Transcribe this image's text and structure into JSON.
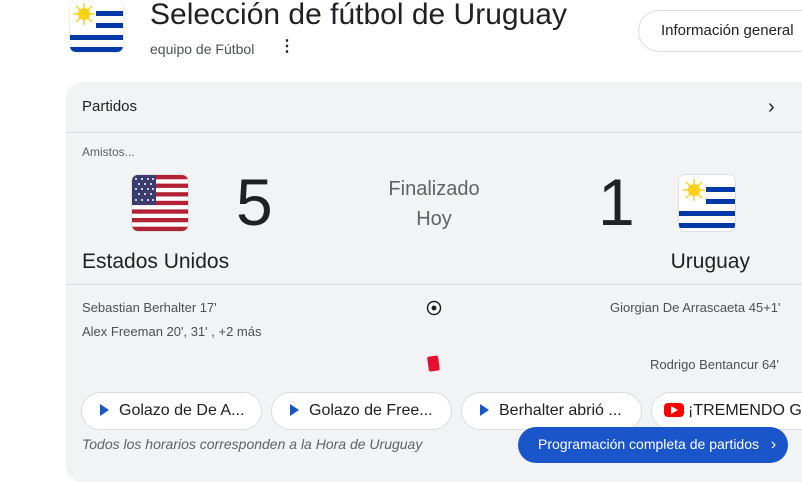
{
  "header": {
    "title": "Selección de fútbol de Uruguay",
    "subtitle": "equipo de Fútbol",
    "more_icon": "⋮",
    "info_button": "Información general"
  },
  "card": {
    "title": "Partidos",
    "chevron": "›",
    "competition": "Amistos...",
    "status": "Finalizado",
    "date": "Hoy",
    "home": {
      "name": "Estados Unidos",
      "score": "5",
      "flag": "usa-flag-icon"
    },
    "away": {
      "name": "Uruguay",
      "score": "1",
      "flag": "uruguay-flag-icon"
    },
    "events": {
      "home_goals_1": "Sebastian Berhalter 17'",
      "home_goals_2": "Alex Freeman 20', 31' , +2 más",
      "away_goals_1": "Giorgian De Arrascaeta 45+1'",
      "away_red_card": "Rodrigo Bentancur 64'"
    },
    "chips": [
      {
        "label": "Golazo de De A...",
        "icon": "play-icon"
      },
      {
        "label": "Golazo de Free...",
        "icon": "play-icon"
      },
      {
        "label": "Berhalter abrió ...",
        "icon": "play-icon"
      },
      {
        "label": "¡TREMENDO GOL",
        "icon": "youtube-icon"
      }
    ],
    "footnote": "Todos los horarios corresponden a la Hora de Uruguay",
    "schedule_button": "Programación completa de partidos",
    "schedule_chevron": "›"
  },
  "colors": {
    "accent": "#1a56c9",
    "card_bg": "#f1f3f4",
    "red_card": "#e8112d",
    "youtube": "#ff0000"
  }
}
